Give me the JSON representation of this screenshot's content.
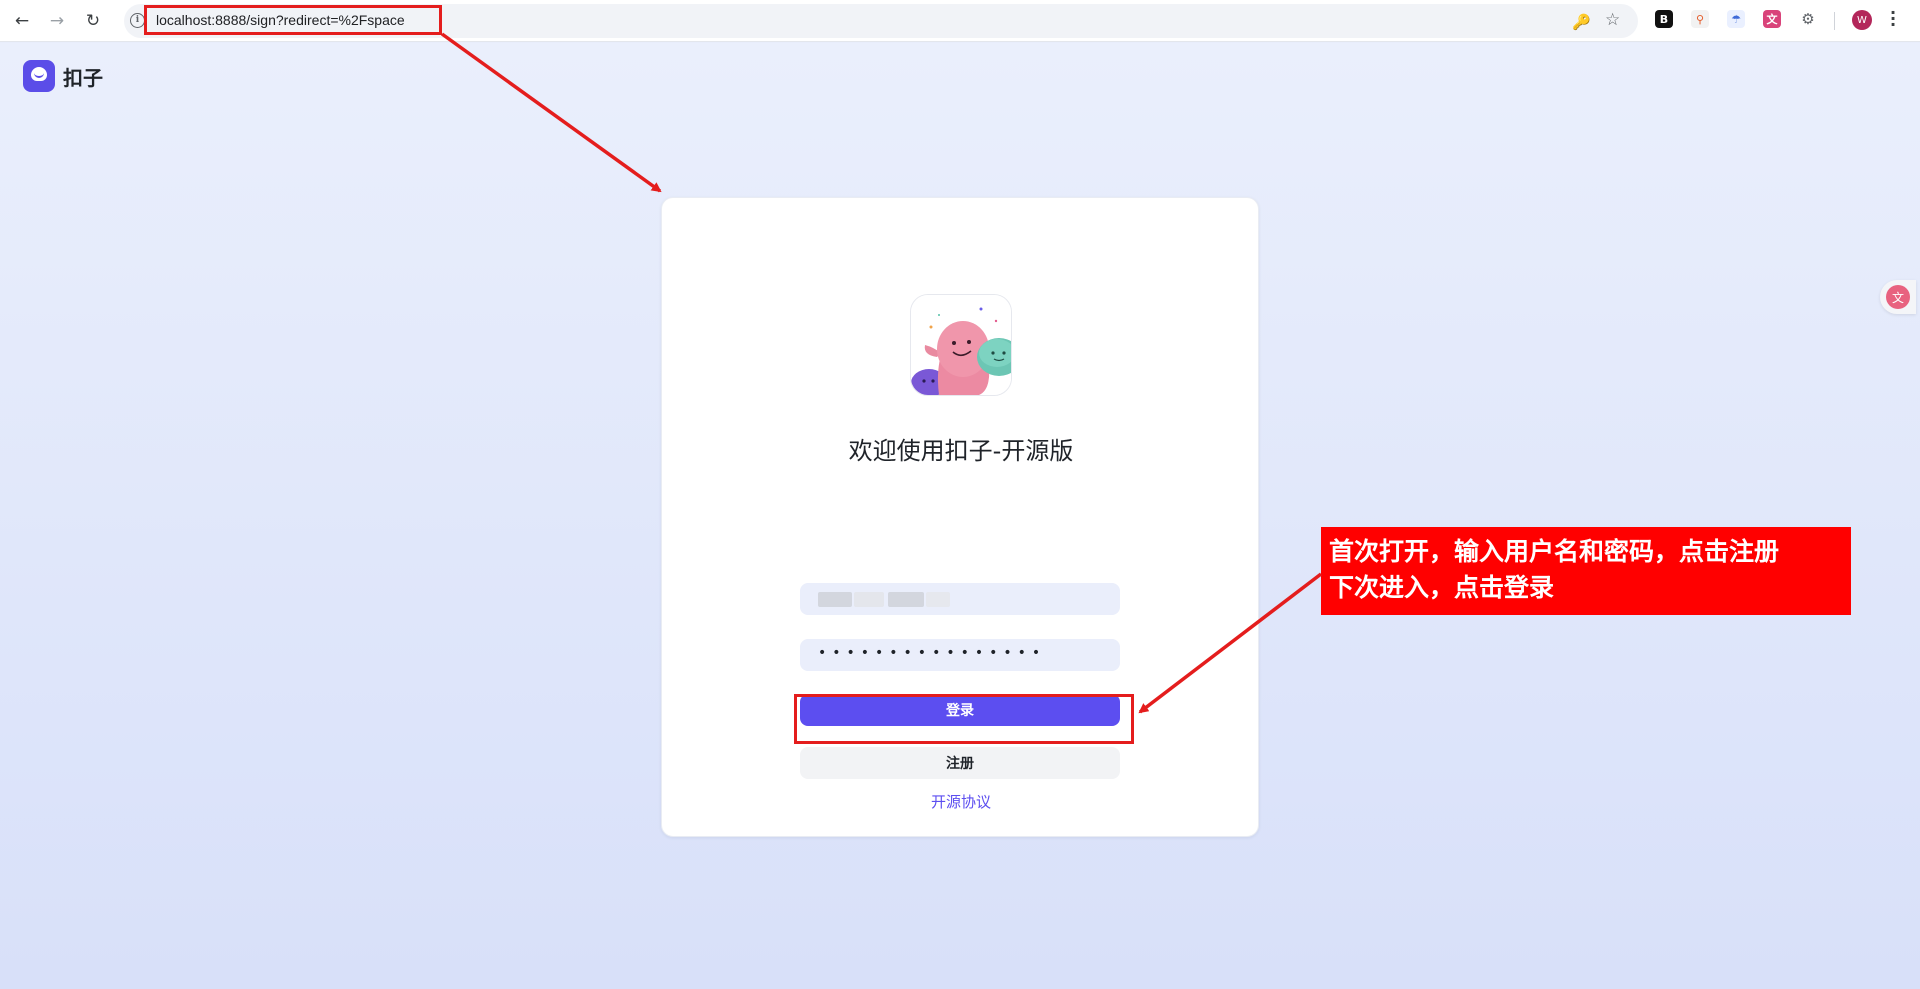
{
  "browser": {
    "url": "localhost:8888/sign?redirect=%2Fspace",
    "avatar_initial": "W",
    "back_icon": "arrow-left-icon",
    "forward_icon": "arrow-right-icon",
    "reload_icon": "reload-icon"
  },
  "brand": {
    "name": "扣子"
  },
  "login": {
    "title": "欢迎使用扣子-开源版",
    "password_mask": "••••••••••••••••",
    "login_label": "登录",
    "register_label": "注册",
    "agreement_label": "开源协议"
  },
  "annotation": {
    "note_line1": "首次打开，输入用户名和密码，点击注册",
    "note_line2": "下次进入，点击登录",
    "color": "#ff0000"
  },
  "colors": {
    "primary": "#5c4ef0",
    "annotation_red": "#e41d1d"
  }
}
